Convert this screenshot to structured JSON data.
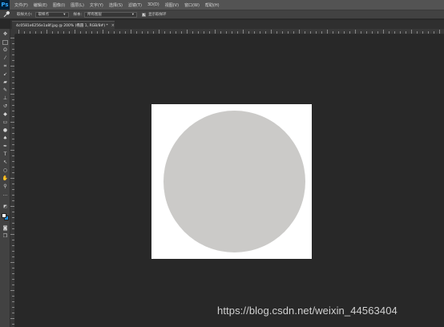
{
  "app": {
    "logo": "Ps"
  },
  "menu": [
    "文件(F)",
    "编辑(E)",
    "图像(I)",
    "图层(L)",
    "文字(Y)",
    "选择(S)",
    "滤镜(T)",
    "3D(D)",
    "视图(V)",
    "窗口(W)",
    "帮助(H)"
  ],
  "options": {
    "tool_icon": "eyedropper-icon",
    "sample_size_label": "取样大小:",
    "sample_size_value": "取样点",
    "sample_label": "样本:",
    "sample_value": "所有图层",
    "show_ring_label": "显示取样环",
    "show_ring_checked": true
  },
  "document": {
    "tab_title": "4c0581e6256e1a8f.jpg @ 200% (椭圆 1, RGB/8#) *",
    "close_glyph": "×"
  },
  "canvas": {
    "background": "#ffffff",
    "shape_color": "#cbcac8"
  },
  "colors": {
    "foreground": "#ffffff",
    "background": "#1e8fe0"
  },
  "watermark": "https://blog.csdn.net/weixin_44563404"
}
